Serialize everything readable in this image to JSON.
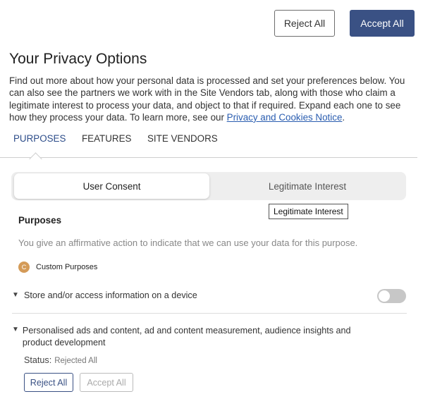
{
  "header": {
    "reject_all": "Reject All",
    "accept_all": "Accept All"
  },
  "title": "Your Privacy Options",
  "intro": {
    "text": "Find out more about how your personal data is processed and set your preferences below. You can also see the partners we work with in the Site Vendors tab, along with those who claim a legitimate interest to process your data, and object to that if required. Expand each one to see how they process your data. To learn more, see our ",
    "link": "Privacy and Cookies Notice",
    "suffix": "."
  },
  "tabs": [
    {
      "label": "PURPOSES",
      "active": true
    },
    {
      "label": "FEATURES",
      "active": false
    },
    {
      "label": "SITE VENDORS",
      "active": false
    }
  ],
  "consent_toggle": {
    "user": "User Consent",
    "legit": "Legitimate Interest",
    "selected": "user"
  },
  "tooltip": "Legitimate Interest",
  "purposes": {
    "title": "Purposes",
    "description": "You give an affirmative action to indicate that we can use your data for this purpose.",
    "custom_badge": "C",
    "custom_label": "Custom Purposes"
  },
  "items": [
    {
      "label": "Store and/or access information on a device",
      "enabled": false
    },
    {
      "label": "Personalised ads and content, ad and content measurement, audience insights and product development"
    }
  ],
  "status": {
    "label": "Status:",
    "value": "Rejected All"
  },
  "section_buttons": {
    "reject_all": "Reject All",
    "accept_all": "Accept All"
  },
  "colors": {
    "accent": "#3a5184",
    "link": "#2a5db0",
    "badge": "#d49b58"
  },
  "icons": {
    "chevron": "chevron-down-icon"
  }
}
